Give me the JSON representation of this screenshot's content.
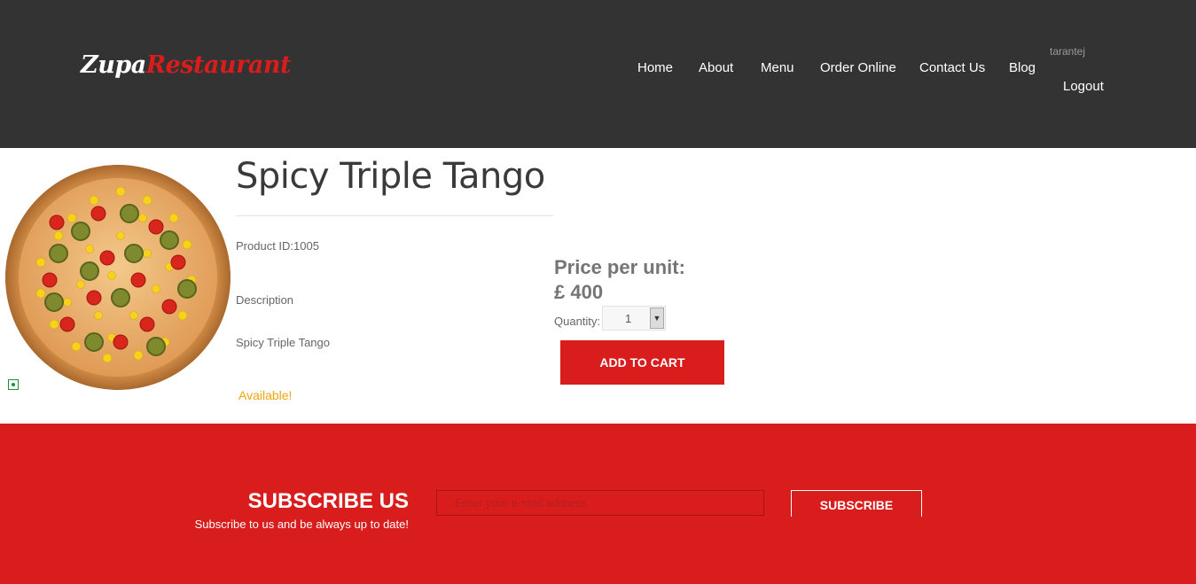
{
  "header": {
    "logo": {
      "part1": "Zupa",
      "part2": "Restaurant"
    },
    "nav": [
      {
        "label": "Home"
      },
      {
        "label": "About"
      },
      {
        "label": "Menu"
      },
      {
        "label": "Order Online"
      },
      {
        "label": "Contact Us"
      },
      {
        "label": "Blog"
      }
    ],
    "username": "tarantej",
    "logout_label": "Logout"
  },
  "product": {
    "title": "Spicy Triple Tango",
    "product_id_text": "Product ID:1005",
    "description_label": "Description",
    "description": "Spicy Triple Tango",
    "availability": "Available!",
    "price_label": "Price per unit:",
    "price": "£ 400",
    "quantity_label": "Quantity:",
    "quantity": "1",
    "add_to_cart_label": "ADD TO CART",
    "image_icon": "pizza-image"
  },
  "subscribe": {
    "title": "SUBSCRIBE US",
    "subtitle": "Subscribe to us and be always up to date!",
    "email_placeholder": "Enter your e-mail address",
    "button_label": "SUBSCRIBE"
  },
  "colors": {
    "header_bg": "#333333",
    "accent": "#d91c1c",
    "available": "#f1a30b",
    "price_text": "#757575"
  }
}
